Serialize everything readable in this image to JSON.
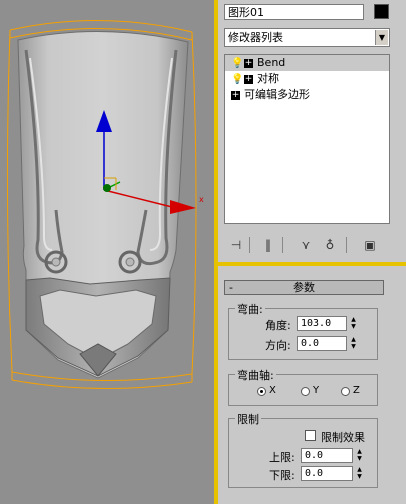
{
  "viewport": {
    "axis_x_label": "x",
    "colors": {
      "background": "#8f8f8f",
      "bbox": "#f5a000",
      "axis_x": "#d40000",
      "axis_y": "#00a000",
      "axis_z": "#0000d0"
    }
  },
  "panel": {
    "object_name": "图形01",
    "object_color": "#000000",
    "modifier_list": "修改器列表",
    "stack": [
      {
        "label": "Bend",
        "icon": "lightbulb-icon",
        "selected": true
      },
      {
        "label": "对称",
        "icon": "lightbulb-icon",
        "selected": false
      },
      {
        "label": "可编辑多边形",
        "icon": "",
        "selected": false
      }
    ],
    "toolbar_icons": [
      "pin-stack-icon",
      "show-end-result-icon",
      "make-unique-icon",
      "remove-modifier-icon",
      "configure-sets-icon"
    ]
  },
  "params": {
    "rollout_title": "参数",
    "rollout_toggle": "-",
    "bend": {
      "title": "弯曲:",
      "angle_label": "角度:",
      "angle_value": "103.0",
      "direction_label": "方向:",
      "direction_value": "0.0"
    },
    "bend_axis": {
      "title": "弯曲轴:",
      "options": [
        "X",
        "Y",
        "Z"
      ],
      "selected": "X"
    },
    "limits": {
      "title": "限制",
      "limit_effect_label": "限制效果",
      "limit_effect_checked": false,
      "upper_label": "上限:",
      "upper_value": "0.0",
      "lower_label": "下限:",
      "lower_value": "0.0"
    }
  }
}
